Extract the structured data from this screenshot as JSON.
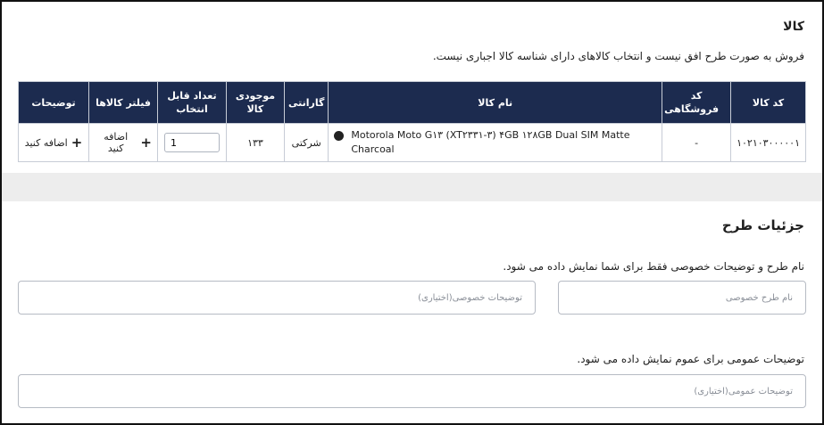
{
  "goods": {
    "title": "کالا",
    "notice": "فروش به صورت طرح افق نیست و انتخاب کالاهای دارای شناسه کالا اجباری نیست.",
    "columns": {
      "code": "کد کالا",
      "store_code": "کد فروشگاهی",
      "name": "نام کالا",
      "warranty": "گارانتی",
      "stock": "موجودی کالا",
      "selectable_qty": "تعداد قابل انتخاب",
      "filter": "فیلتر کالاها",
      "description": "توضیحات"
    },
    "rows": [
      {
        "code": "۱۰۲۱۰۳۰۰۰۰۰۱",
        "store_code": "-",
        "name": "Motorola Moto G۱۳ (XT۲۳۳۱-۳) ۴GB ۱۲۸GB Dual SIM Matte Charcoal",
        "color": "#222222",
        "warranty": "شرکتی",
        "stock": "۱۳۳",
        "qty": "1",
        "filter_label": "اضافه کنید",
        "description_label": "اضافه کنید"
      }
    ]
  },
  "plan": {
    "title": "جزئیات طرح",
    "private_note": "نام طرح و توضیحات خصوصی فقط برای شما نمایش داده می شود.",
    "plan_name_placeholder": "نام طرح خصوصی",
    "private_desc_placeholder": "توضیحات خصوصی(اختیاری)",
    "public_note": "توضیحات عمومی برای عموم نمایش داده می شود.",
    "public_desc_placeholder": "توضیحات عمومی(اختیاری)"
  },
  "colors": {
    "header_bg": "#1c2b4f",
    "band": "#ededed"
  }
}
